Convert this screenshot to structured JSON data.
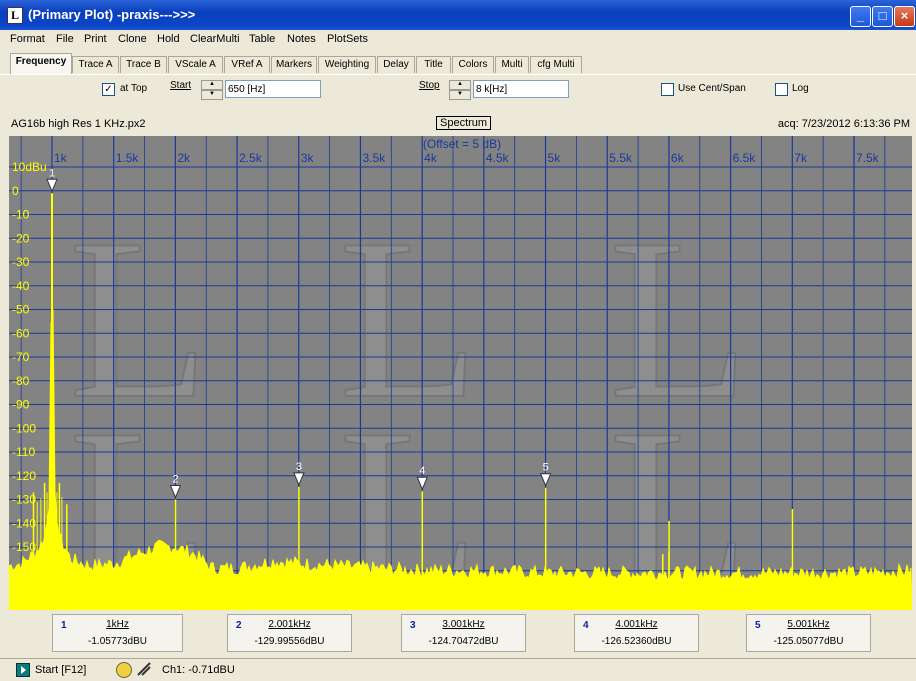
{
  "window": {
    "title": "(Primary Plot) -praxis--->>>",
    "app_icon": "L",
    "buttons": {
      "minimize": "_",
      "maximize": "□",
      "close": "×"
    }
  },
  "menu": [
    "Format",
    "File",
    "Print",
    "Clone",
    "Hold",
    "ClearMulti",
    "Table",
    "Notes",
    "PlotSets"
  ],
  "tabs": [
    "Frequency",
    "Trace A",
    "Trace B",
    "VScale A",
    "VRef A",
    "Markers",
    "Weighting",
    "Delay",
    "Title",
    "Colors",
    "Multi",
    "cfg Multi"
  ],
  "toolbar": {
    "at_top_label": "at Top",
    "at_top_checked": "✓",
    "start_label": "Start",
    "start_value": "650 [Hz]",
    "stop_label": "Stop",
    "stop_value": "8 k[Hz]",
    "use_cent_span_label": "Use Cent/Span",
    "log_label": "Log"
  },
  "info": {
    "filename": "AG16b high Res 1 KHz.px2",
    "mode": "Spectrum",
    "acq": "acq: 7/23/2012 6:13:36 PM"
  },
  "plot": {
    "offset_label": "(Offset = 5 dB)",
    "background": "#838383",
    "grid_color": "#1a3a9a",
    "trace_color": "#ffff00"
  },
  "chart_data": {
    "type": "line",
    "title": "",
    "xlabel": "",
    "ylabel": "",
    "xlim": [
      650,
      8000
    ],
    "ylim": [
      -165,
      15
    ],
    "x_ticks": [
      "1k",
      "1.5k",
      "2k",
      "2.5k",
      "3k",
      "3.5k",
      "4k",
      "4.5k",
      "5k",
      "5.5k",
      "6k",
      "6.5k",
      "7k",
      "7.5k"
    ],
    "x_tick_values": [
      1000,
      1500,
      2000,
      2500,
      3000,
      3500,
      4000,
      4500,
      5000,
      5500,
      6000,
      6500,
      7000,
      7500
    ],
    "y_ticks": [
      "10dBu",
      "0",
      "-10",
      "-20",
      "-30",
      "-40",
      "-50",
      "-60",
      "-70",
      "-80",
      "-90",
      "-100",
      "-110",
      "-120",
      "-130",
      "-140",
      "-150"
    ],
    "y_tick_values": [
      10,
      0,
      -10,
      -20,
      -30,
      -40,
      -50,
      -60,
      -70,
      -80,
      -90,
      -100,
      -110,
      -120,
      -130,
      -140,
      -150
    ],
    "noise_floor": [
      [
        650,
        -158
      ],
      [
        750,
        -157
      ],
      [
        850,
        -153
      ],
      [
        900,
        -150
      ],
      [
        950,
        -144
      ],
      [
        980,
        -130
      ],
      [
        1000,
        -1.06
      ],
      [
        1020,
        -128
      ],
      [
        1060,
        -146
      ],
      [
        1150,
        -155
      ],
      [
        1300,
        -158
      ],
      [
        1500,
        -157
      ],
      [
        1700,
        -153
      ],
      [
        1850,
        -150
      ],
      [
        2000,
        -150
      ],
      [
        2150,
        -153
      ],
      [
        2300,
        -159
      ],
      [
        2500,
        -159
      ],
      [
        2800,
        -156
      ],
      [
        3000,
        -157
      ],
      [
        3300,
        -158
      ],
      [
        3600,
        -159
      ],
      [
        4000,
        -160
      ],
      [
        4500,
        -160
      ],
      [
        5000,
        -161
      ],
      [
        5500,
        -161
      ],
      [
        6000,
        -161
      ],
      [
        6500,
        -161
      ],
      [
        7000,
        -161
      ],
      [
        7500,
        -161
      ],
      [
        8000,
        -160
      ]
    ],
    "spurs": [
      {
        "x": 850,
        "y": -127
      },
      {
        "x": 940,
        "y": -123
      },
      {
        "x": 1060,
        "y": -123
      },
      {
        "x": 1120,
        "y": -132
      },
      {
        "x": 2001,
        "y": -129.99556
      },
      {
        "x": 3001,
        "y": -124.70472
      },
      {
        "x": 4001,
        "y": -126.5236
      },
      {
        "x": 5001,
        "y": -125.05077
      },
      {
        "x": 5950,
        "y": -153
      },
      {
        "x": 6000,
        "y": -152
      },
      {
        "x": 6001,
        "y": -139
      },
      {
        "x": 7001,
        "y": -134
      }
    ]
  },
  "markers": [
    {
      "num": "1",
      "freq": "1kHz",
      "level": "-1.05773dBU",
      "x": 1000,
      "y": -1.05773
    },
    {
      "num": "2",
      "freq": "2.001kHz",
      "level": "-129.99556dBU",
      "x": 2001,
      "y": -129.99556
    },
    {
      "num": "3",
      "freq": "3.001kHz",
      "level": "-124.70472dBU",
      "x": 3001,
      "y": -124.70472
    },
    {
      "num": "4",
      "freq": "4.001kHz",
      "level": "-126.52360dBU",
      "x": 4001,
      "y": -126.5236
    },
    {
      "num": "5",
      "freq": "5.001kHz",
      "level": "-125.05077dBU",
      "x": 5001,
      "y": -125.05077
    }
  ],
  "status": {
    "start_label": "Start [F12]",
    "channel_readout": "Ch1: -0.71dBU"
  }
}
